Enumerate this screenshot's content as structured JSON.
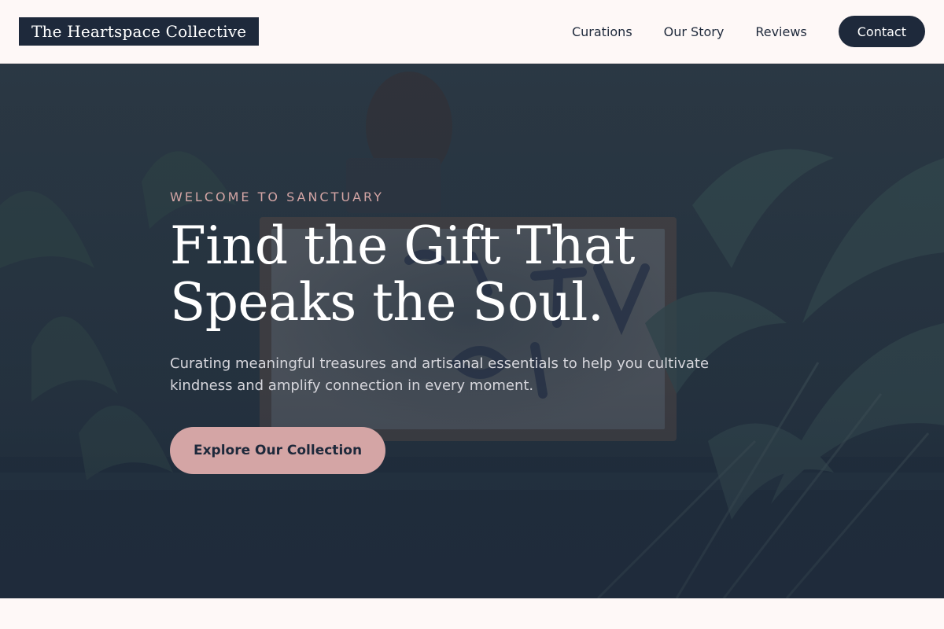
{
  "brand": {
    "name": "The Heartspace Collective"
  },
  "nav": {
    "items": [
      {
        "label": "Curations"
      },
      {
        "label": "Our Story"
      },
      {
        "label": "Reviews"
      }
    ],
    "contact_label": "Contact"
  },
  "hero": {
    "eyebrow": "WELCOME TO SANCTUARY",
    "title_line1": "Find the Gift That",
    "title_line2": "Speaks the Soul.",
    "subtitle": "Curating meaningful treasures and artisanal essentials to help you cultivate kindness and amplify connection in every moment.",
    "cta_label": "Explore Our Collection",
    "background_image": "shop-window-open-sign-with-plants"
  },
  "colors": {
    "primary": "#1e293b",
    "accent": "#d4a5a5",
    "background": "#fef8f7",
    "on_dark": "#ffffff"
  }
}
